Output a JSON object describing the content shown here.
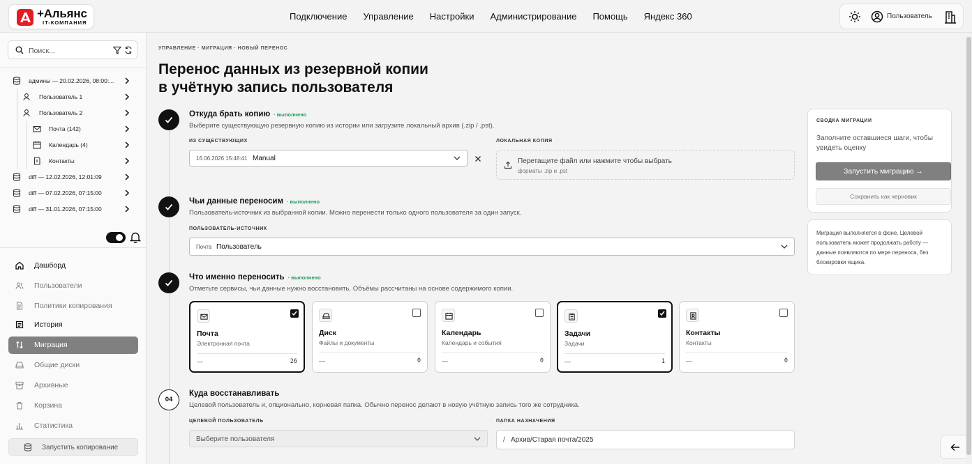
{
  "brand": {
    "name": "+Альянс",
    "sub": "IT-КОМПАНИЯ",
    "color": "#e21d24"
  },
  "topnav": [
    "Подключение",
    "Управление",
    "Настройки",
    "Администрирование",
    "Помощь",
    "Яндекс 360"
  ],
  "user": {
    "name": "Пользователь"
  },
  "search": {
    "placeholder": "Поиск..."
  },
  "tree": [
    {
      "label": "админы — 20.02.2026, 08:00:...",
      "icon": "database-icon",
      "level": 0
    },
    {
      "label": "Пользователь 1",
      "icon": "user-icon",
      "level": 1
    },
    {
      "label": "Пользователь 2",
      "icon": "user-icon",
      "level": 1
    },
    {
      "label": "Почта (142)",
      "icon": "mail-icon",
      "level": 2
    },
    {
      "label": "Календарь (4)",
      "icon": "calendar-icon",
      "level": 2
    },
    {
      "label": "Контакты",
      "icon": "contact-icon",
      "level": 2
    },
    {
      "label": "diff — 12.02.2026, 12:01:09",
      "icon": "database-icon",
      "level": 0
    },
    {
      "label": "diff — 07.02.2026, 07:15:00",
      "icon": "database-icon",
      "level": 0
    },
    {
      "label": "diff — 31.01.2026, 07:15:00",
      "icon": "database-icon",
      "level": 0
    }
  ],
  "nav": [
    {
      "label": "Дашборд",
      "icon": "home-icon",
      "style": "bold"
    },
    {
      "label": "Пользователи",
      "icon": "users-icon",
      "style": "muted"
    },
    {
      "label": "Политики копирования",
      "icon": "document-icon",
      "style": "muted"
    },
    {
      "label": "История",
      "icon": "history-icon",
      "style": "bold"
    },
    {
      "label": "Миграция",
      "icon": "migration-icon",
      "style": "active"
    },
    {
      "label": "Общие диски",
      "icon": "drive-icon",
      "style": "muted"
    },
    {
      "label": "Архивные",
      "icon": "archive-icon",
      "style": "muted"
    },
    {
      "label": "Корзина",
      "icon": "trash-icon",
      "style": "muted"
    },
    {
      "label": "Статистика",
      "icon": "stats-icon",
      "style": "muted"
    }
  ],
  "launch_copy": "Запустить копирование",
  "breadcrumb": "УПРАВЛЕНИЕ · МИГРАЦИЯ · НОВЫЙ ПЕРЕНОС",
  "title_line1": "Перенос данных из резервной копии",
  "title_line2": "в учётную запись пользователя",
  "steps": {
    "s1": {
      "title": "Откуда брать копию",
      "status": "· выполнено",
      "desc": "Выберите существующую резервную копию из истории или загрузите локальный архив (.zip / .pst).",
      "existing_label": "ИЗ СУЩЕСТВУЮЩИХ",
      "existing_date": "16.06.2026 15:48:41",
      "existing_value": "Manual",
      "local_label": "ЛОКАЛЬНАЯ КОПИЯ",
      "drop_text": "Перетащите файл или нажмите чтобы выбрать",
      "drop_hint": "форматы .zip и .pst"
    },
    "s2": {
      "title": "Чьи данные переносим",
      "status": "· выполнено",
      "desc": "Пользователь-источник из выбранной копии. Можно перенести только одного пользователя за один запуск.",
      "label": "ПОЛЬЗОВАТЕЛЬ-ИСТОЧНИК",
      "prefix": "Почта",
      "value": "Пользователь"
    },
    "s3": {
      "title": "Что именно переносить",
      "status": "· выполнено",
      "desc": "Отметьте сервисы, чьи данные нужно восстановить. Объёмы рассчитаны на основе содержимого копии."
    },
    "s4": {
      "number": "04",
      "title": "Куда восстанавливать",
      "desc": "Целевой пользователь и, опционально, корневая папка. Обычно перенос делают в новую учётную запись того же сотрудника.",
      "target_label": "ЦЕЛЕВОЙ ПОЛЬЗОВАТЕЛЬ",
      "target_placeholder": "Выберите пользователя",
      "folder_label": "ПАПКА НАЗНАЧЕНИЯ",
      "folder_prefix": "/",
      "folder_value": "Архив/Старая почта/2025"
    }
  },
  "services": [
    {
      "title": "Почта",
      "sub": "Электронная почта",
      "dash": "—",
      "count": "26",
      "checked": true,
      "icon": "mail-icon"
    },
    {
      "title": "Диск",
      "sub": "Файлы и документы",
      "dash": "—",
      "count": "0",
      "checked": false,
      "icon": "disk-icon"
    },
    {
      "title": "Календарь",
      "sub": "Календарь и события",
      "dash": "—",
      "count": "0",
      "checked": false,
      "icon": "calendar-icon"
    },
    {
      "title": "Задачи",
      "sub": "Задачи",
      "dash": "—",
      "count": "1",
      "checked": true,
      "icon": "tasks-icon"
    },
    {
      "title": "Контакты",
      "sub": "Контакты",
      "dash": "—",
      "count": "0",
      "checked": false,
      "icon": "contact-icon"
    }
  ],
  "summary": {
    "heading": "СВОДКА МИГРАЦИИ",
    "text": "Заполните оставшиеся шаги, чтобы увидеть оценку",
    "run": "Запустить миграцию →",
    "draft": "Сохранить как черновик"
  },
  "note": "Миграция выполняется в фоне. Целевой пользователь может продолжать работу — данные появляются по мере переноса, без блокировки ящика.",
  "colors": {
    "accent": "#111111",
    "done": "#1a9c5b",
    "active_nav": "#808080"
  }
}
